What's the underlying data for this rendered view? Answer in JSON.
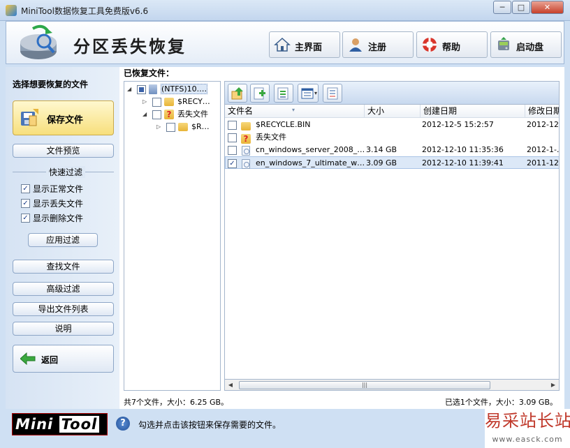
{
  "window": {
    "title": "MiniTool数据恢复工具免费版v6.6",
    "min_glyph": "─",
    "max_glyph": "□",
    "close_glyph": "✕"
  },
  "banner": {
    "title": "分区丢失恢复",
    "nav": [
      {
        "label": "主界面",
        "icon": "home-icon"
      },
      {
        "label": "注册",
        "icon": "user-icon"
      },
      {
        "label": "帮助",
        "icon": "lifebuoy-icon"
      },
      {
        "label": "启动盘",
        "icon": "boot-disk-icon"
      }
    ]
  },
  "sidebar": {
    "heading": "选择想要恢复的文件",
    "save_label": "保存文件",
    "preview_label": "文件预览",
    "filter_group_label": "快速过滤",
    "filters": [
      {
        "label": "显示正常文件",
        "checked": true
      },
      {
        "label": "显示丢失文件",
        "checked": true
      },
      {
        "label": "显示删除文件",
        "checked": true
      }
    ],
    "apply_filter_label": "应用过滤",
    "find_label": "查找文件",
    "advanced_filter_label": "高级过滤",
    "export_label": "导出文件列表",
    "explain_label": "说明",
    "back_label": "返回"
  },
  "main": {
    "recovered_label": "已恢复文件：",
    "tree": [
      {
        "label": "(NTFS)10.…",
        "level": 0,
        "expand": "◢",
        "icon": "drive-icon",
        "checkbox": "partial"
      },
      {
        "label": "$RECY…",
        "level": 1,
        "expand": "▷",
        "icon": "folder-icon",
        "checkbox": "unchecked"
      },
      {
        "label": "丢失文件",
        "level": 1,
        "expand": "◢",
        "icon": "lost-folder-icon",
        "checkbox": "unchecked"
      },
      {
        "label": "$R…",
        "level": 2,
        "expand": "▷",
        "icon": "folder-icon",
        "checkbox": "unchecked"
      }
    ],
    "toolbar_icons": [
      "up-folder-icon",
      "add-icon",
      "export-icon",
      "view-mode-icon",
      "properties-icon"
    ],
    "columns": [
      "文件名",
      "大小",
      "创建日期",
      "修改日期"
    ],
    "files": [
      {
        "checked": false,
        "icon": "folder-icon",
        "name": "$RECYCLE.BIN",
        "size": "",
        "created": "2012-12-5 15:2:57",
        "modified": "2012-12-…",
        "selected": false
      },
      {
        "checked": false,
        "icon": "lost-folder-icon",
        "name": "丢失文件",
        "size": "",
        "created": "",
        "modified": "",
        "selected": false
      },
      {
        "checked": false,
        "icon": "disc-image-icon",
        "name": "cn_windows_server_2008_…",
        "size": "3.14 GB",
        "created": "2012-12-10 11:35:36",
        "modified": "2012-1-…",
        "selected": false
      },
      {
        "checked": true,
        "icon": "disc-image-icon",
        "name": "en_windows_7_ultimate_w…",
        "size": "3.09 GB",
        "created": "2012-12-10 11:39:41",
        "modified": "2011-12-…",
        "selected": true
      }
    ],
    "summary_left": "共7个文件，大小：6.25 GB。",
    "summary_right": "已选1个文件，大小：3.09 GB。"
  },
  "footer": {
    "logo_part1": "Mini",
    "logo_part2": "Tool",
    "hint": "勾选并点击该按钮来保存需要的文件。"
  },
  "watermark": {
    "cn": "易采站长站",
    "en": "www.easck.com"
  }
}
